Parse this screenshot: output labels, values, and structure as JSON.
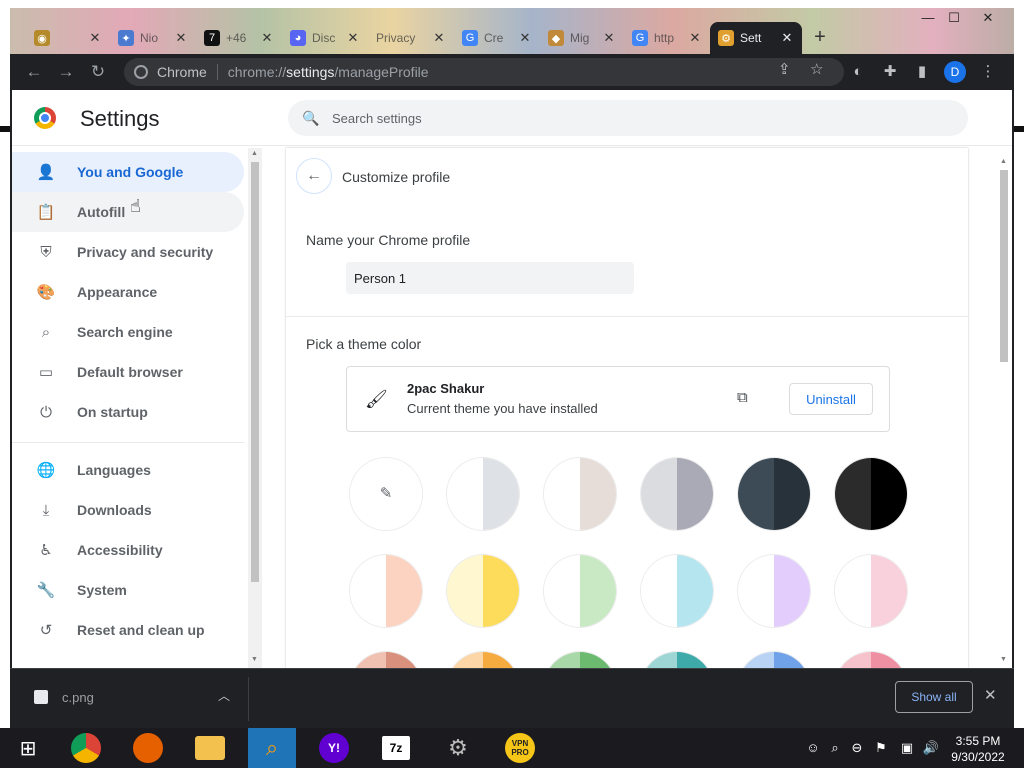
{
  "browser": {
    "tabs": [
      {
        "title": "",
        "favicon": "app-icon",
        "color": "#b58a2a"
      },
      {
        "title": "Nio",
        "favicon": "butterfly-icon",
        "color": "#4a7bd0"
      },
      {
        "title": "+46",
        "favicon": "seven-icon",
        "color": "#111111"
      },
      {
        "title": "Disc",
        "favicon": "discord-icon",
        "color": "#5865f2"
      },
      {
        "title": "Privacy",
        "favicon": "page-icon",
        "color": "#777777"
      },
      {
        "title": "Cre",
        "favicon": "google-icon",
        "color": "#4285f4"
      },
      {
        "title": "Mig",
        "favicon": "generic-icon",
        "color": "#c08a3a"
      },
      {
        "title": "http",
        "favicon": "google-icon",
        "color": "#4285f4"
      },
      {
        "title": "Sett",
        "favicon": "gear-icon",
        "color": "#e0a030"
      }
    ],
    "address": {
      "site": "Chrome",
      "url_prefix": "chrome://",
      "url_host": "settings",
      "url_path": "/manageProfile"
    },
    "profile_initial": "D"
  },
  "settings": {
    "title": "Settings",
    "search_placeholder": "Search settings",
    "nav": [
      {
        "label": "You and Google",
        "icon": "person-icon",
        "glyph": "👤"
      },
      {
        "label": "Autofill",
        "icon": "clipboard-icon",
        "glyph": "📋"
      },
      {
        "label": "Privacy and security",
        "icon": "shield-icon",
        "glyph": "⛨"
      },
      {
        "label": "Appearance",
        "icon": "palette-icon",
        "glyph": "🎨"
      },
      {
        "label": "Search engine",
        "icon": "search-icon",
        "glyph": "⌕"
      },
      {
        "label": "Default browser",
        "icon": "browser-icon",
        "glyph": "▭"
      },
      {
        "label": "On startup",
        "icon": "power-icon",
        "glyph": "⏻"
      },
      {
        "label": "Languages",
        "icon": "globe-icon",
        "glyph": "🌐"
      },
      {
        "label": "Downloads",
        "icon": "download-icon",
        "glyph": "⤓"
      },
      {
        "label": "Accessibility",
        "icon": "accessibility-icon",
        "glyph": "♿"
      },
      {
        "label": "System",
        "icon": "wrench-icon",
        "glyph": "🔧"
      },
      {
        "label": "Reset and clean up",
        "icon": "history-icon",
        "glyph": "↺"
      }
    ],
    "main": {
      "title": "Customize profile",
      "name_label": "Name your Chrome profile",
      "name_value": "Person 1",
      "theme_label": "Pick a theme color",
      "theme_card": {
        "name": "2pac Shakur",
        "subtitle": "Current theme you have installed",
        "button": "Uninstall"
      },
      "swatches": [
        [
          "#ffffff",
          "#ffffff"
        ],
        [
          "#ffffff",
          "#dee1e6"
        ],
        [
          "#ffffff",
          "#e6dcd8"
        ],
        [
          "#dadce0",
          "#a9aab5"
        ],
        [
          "#3c4b56",
          "#27323a"
        ],
        [
          "#2b2b2b",
          "#000000"
        ],
        [
          "#ffffff",
          "#fcd2c1"
        ],
        [
          "#fef7d0",
          "#fddc5c"
        ],
        [
          "#ffffff",
          "#c9e9c4"
        ],
        [
          "#ffffff",
          "#b5e6ef"
        ],
        [
          "#ffffff",
          "#e3cdfc"
        ],
        [
          "#ffffff",
          "#f9d1dd"
        ],
        [
          "#f0c0b0",
          "#d9907c"
        ],
        [
          "#fcd6a6",
          "#f6ab41"
        ],
        [
          "#a9d8a8",
          "#6bba70"
        ],
        [
          "#9ed6d6",
          "#3eaaaa"
        ],
        [
          "#b9d3f5",
          "#6fa2e8"
        ],
        [
          "#f6c2cc",
          "#ef8fa2"
        ]
      ]
    }
  },
  "downloads": {
    "file": "c.png",
    "show_all": "Show all"
  },
  "taskbar": {
    "time": "3:55 PM",
    "date": "9/30/2022",
    "vpn_label": "VPN PRO",
    "zip_label": "7z"
  },
  "colors": {
    "accent": "#1a73e8",
    "active_nav_bg": "#e8f0fe",
    "toolbar": "#202124"
  }
}
